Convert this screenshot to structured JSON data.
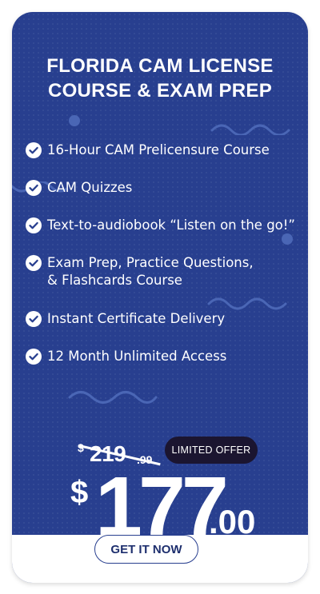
{
  "card": {
    "title_lines": [
      "FLORIDA CAM LICENSE",
      "COURSE & EXAM PREP"
    ],
    "features": [
      {
        "lines": [
          "16-Hour CAM Prelicensure Course"
        ]
      },
      {
        "lines": [
          "CAM Quizzes"
        ]
      },
      {
        "lines": [
          "Text-to-audiobook “Listen on the go!”"
        ]
      },
      {
        "lines": [
          "Exam Prep, Practice Questions,",
          "& Flashcards Course"
        ]
      },
      {
        "lines": [
          "Instant Certificate Delivery"
        ]
      },
      {
        "lines": [
          "12 Month Unlimited Access"
        ]
      }
    ],
    "old_price": {
      "currency": "$",
      "amount": "219",
      "cents": ".99"
    },
    "offer_badge": "LIMITED OFFER",
    "new_price": {
      "currency": "$",
      "amount": "177",
      "cents": ".00"
    },
    "cta_label": "GET IT NOW",
    "icons": {
      "feature_bullet": "check-circle-icon"
    },
    "colors": {
      "card_bg": "#283f8f",
      "text": "#ffffff",
      "badge_bg": "#1b1530",
      "cta_border": "#283f8f",
      "decor": "#4a66b5"
    }
  }
}
